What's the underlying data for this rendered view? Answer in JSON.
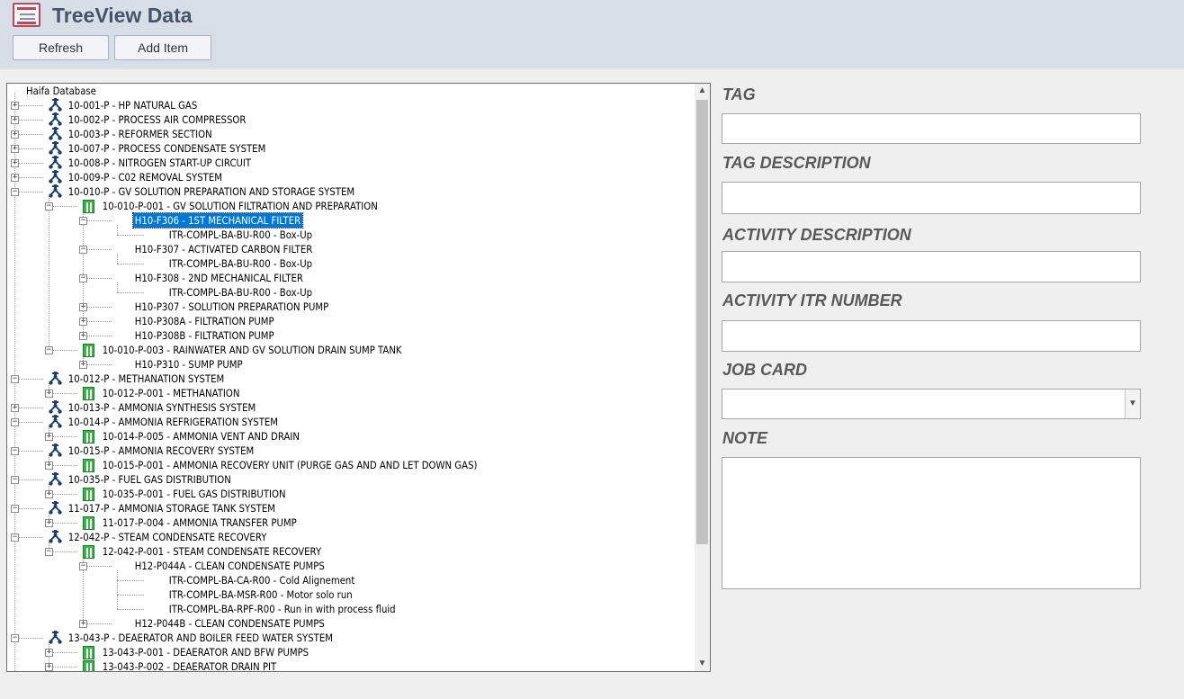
{
  "header": {
    "title": "TreeView Data",
    "buttons": {
      "refresh": "Refresh",
      "add_item": "Add Item"
    }
  },
  "tree": {
    "root": "Haifa Database",
    "selected": "H10-F306 - 1ST MECHANICAL FILTER",
    "rows": [
      {
        "t": "10-001-P - HP NATURAL GAS",
        "l": 0,
        "i": "system",
        "e": "+"
      },
      {
        "t": "10-002-P - PROCESS AIR COMPRESSOR",
        "l": 0,
        "i": "system",
        "e": "+"
      },
      {
        "t": "10-003-P - REFORMER SECTION",
        "l": 0,
        "i": "system",
        "e": "+"
      },
      {
        "t": "10-007-P - PROCESS CONDENSATE SYSTEM",
        "l": 0,
        "i": "system",
        "e": "+"
      },
      {
        "t": "10-008-P - NITROGEN START-UP CIRCUIT",
        "l": 0,
        "i": "system",
        "e": "+"
      },
      {
        "t": "10-009-P - C02 REMOVAL SYSTEM",
        "l": 0,
        "i": "system",
        "e": "+"
      },
      {
        "t": "10-010-P - GV SOLUTION PREPARATION AND STORAGE SYSTEM",
        "l": 0,
        "i": "system",
        "e": "-"
      },
      {
        "t": "10-010-P-001 - GV SOLUTION FILTRATION AND PREPARATION",
        "l": 1,
        "i": "package",
        "e": "-"
      },
      {
        "t": "H10-F306 - 1ST MECHANICAL FILTER",
        "l": 2,
        "i": "",
        "e": "-",
        "sel": true
      },
      {
        "t": "ITR-COMPL-BA-BU-R00 - Box-Up",
        "l": 3,
        "i": "",
        "e": ""
      },
      {
        "t": "H10-F307 - ACTIVATED CARBON FILTER",
        "l": 2,
        "i": "",
        "e": "-"
      },
      {
        "t": "ITR-COMPL-BA-BU-R00 - Box-Up",
        "l": 3,
        "i": "",
        "e": ""
      },
      {
        "t": "H10-F308 - 2ND MECHANICAL FILTER",
        "l": 2,
        "i": "",
        "e": "-"
      },
      {
        "t": "ITR-COMPL-BA-BU-R00 - Box-Up",
        "l": 3,
        "i": "",
        "e": ""
      },
      {
        "t": "H10-P307 - SOLUTION PREPARATION PUMP",
        "l": 2,
        "i": "",
        "e": "+"
      },
      {
        "t": "H10-P308A - FILTRATION PUMP",
        "l": 2,
        "i": "",
        "e": "+"
      },
      {
        "t": "H10-P308B - FILTRATION PUMP",
        "l": 2,
        "i": "",
        "e": "+"
      },
      {
        "t": "10-010-P-003 - RAINWATER AND GV SOLUTION DRAIN SUMP TANK",
        "l": 1,
        "i": "package",
        "e": "-"
      },
      {
        "t": "H10-P310 - SUMP PUMP",
        "l": 2,
        "i": "",
        "e": "+"
      },
      {
        "t": "10-012-P - METHANATION SYSTEM",
        "l": 0,
        "i": "system",
        "e": "-"
      },
      {
        "t": "10-012-P-001 - METHANATION",
        "l": 1,
        "i": "package",
        "e": "+"
      },
      {
        "t": "10-013-P - AMMONIA SYNTHESIS SYSTEM",
        "l": 0,
        "i": "system",
        "e": "+"
      },
      {
        "t": "10-014-P - AMMONIA REFRIGERATION SYSTEM",
        "l": 0,
        "i": "system",
        "e": "-"
      },
      {
        "t": "10-014-P-005 - AMMONIA VENT AND DRAIN",
        "l": 1,
        "i": "package",
        "e": "+"
      },
      {
        "t": "10-015-P - AMMONIA RECOVERY SYSTEM",
        "l": 0,
        "i": "system",
        "e": "-"
      },
      {
        "t": "10-015-P-001 - AMMONIA RECOVERY UNIT (PURGE GAS AND AND LET DOWN GAS)",
        "l": 1,
        "i": "package",
        "e": "+"
      },
      {
        "t": "10-035-P - FUEL GAS DISTRIBUTION",
        "l": 0,
        "i": "system",
        "e": "-"
      },
      {
        "t": "10-035-P-001 - FUEL GAS DISTRIBUTION",
        "l": 1,
        "i": "package",
        "e": "+"
      },
      {
        "t": "11-017-P - AMMONIA STORAGE TANK SYSTEM",
        "l": 0,
        "i": "system",
        "e": "-"
      },
      {
        "t": "11-017-P-004 - AMMONIA TRANSFER PUMP",
        "l": 1,
        "i": "package",
        "e": "+"
      },
      {
        "t": "12-042-P - STEAM CONDENSATE RECOVERY",
        "l": 0,
        "i": "system",
        "e": "-"
      },
      {
        "t": "12-042-P-001 - STEAM CONDENSATE RECOVERY",
        "l": 1,
        "i": "package",
        "e": "-"
      },
      {
        "t": "H12-P044A - CLEAN CONDENSATE PUMPS",
        "l": 2,
        "i": "",
        "e": "-"
      },
      {
        "t": "ITR-COMPL-BA-CA-R00 - Cold Alignement",
        "l": 3,
        "i": "",
        "e": ""
      },
      {
        "t": "ITR-COMPL-BA-MSR-R00 - Motor solo run",
        "l": 3,
        "i": "",
        "e": ""
      },
      {
        "t": "ITR-COMPL-BA-RPF-R00 - Run in with process fluid",
        "l": 3,
        "i": "",
        "e": ""
      },
      {
        "t": "H12-P044B - CLEAN CONDENSATE PUMPS",
        "l": 2,
        "i": "",
        "e": "+"
      },
      {
        "t": "13-043-P -  DEAERATOR AND BOILER FEED WATER SYSTEM",
        "l": 0,
        "i": "system",
        "e": "-"
      },
      {
        "t": "13-043-P-001 - DEAERATOR AND BFW PUMPS",
        "l": 1,
        "i": "package",
        "e": "+"
      },
      {
        "t": "13-043-P-002 -  DEAERATOR DRAIN PIT",
        "l": 1,
        "i": "package",
        "e": "+"
      }
    ]
  },
  "form": {
    "tag_label": "TAG",
    "tag_value": "",
    "tag_description_label": "TAG DESCRIPTION",
    "tag_description_value": "",
    "activity_description_label": "ACTIVITY DESCRIPTION",
    "activity_description_value": "",
    "activity_itr_label": "ACTIVITY ITR NUMBER",
    "activity_itr_value": "",
    "job_card_label": "JOB CARD",
    "job_card_value": "",
    "note_label": "NOTE",
    "note_value": ""
  },
  "colors": {
    "header_bg": "#d8dee8",
    "title": "#44546a",
    "selection": "#0078d7",
    "package_icon": "#39b54a"
  }
}
